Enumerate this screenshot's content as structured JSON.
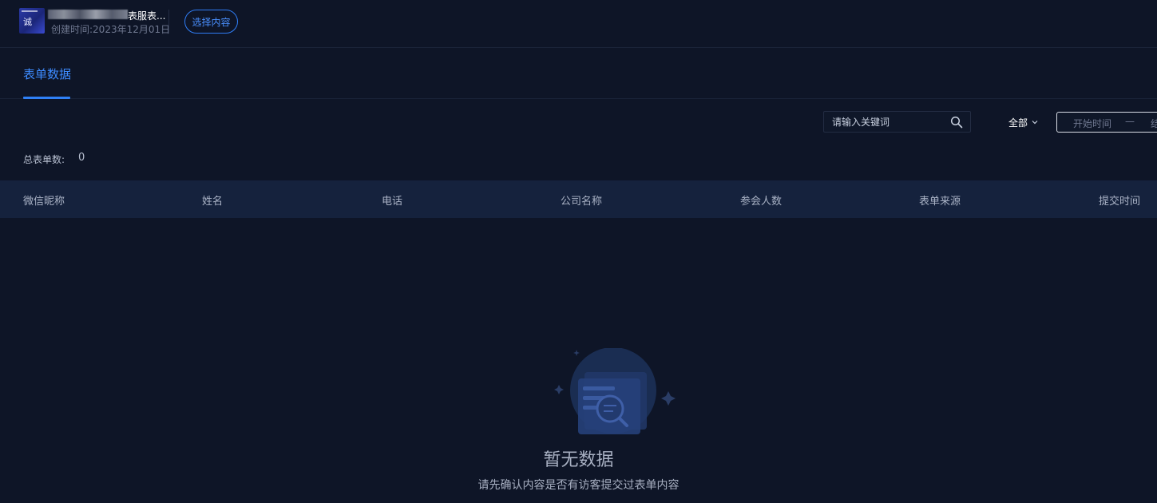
{
  "header": {
    "thumbnail_text": "诚",
    "title_visible_suffix": "表服表...",
    "created_time": "创建时间:2023年12月01日",
    "select_button_label": "选择内容"
  },
  "tabs": [
    {
      "label": "表单数据",
      "active": true
    }
  ],
  "toolbar": {
    "search_placeholder": "请输入关键词",
    "filter_selected": "全部",
    "date_start_placeholder": "开始时间",
    "date_separator": "—",
    "date_end_placeholder": "结"
  },
  "summary": {
    "total_label": "总表单数:",
    "total_value": "0"
  },
  "table": {
    "columns": [
      "微信昵称",
      "姓名",
      "电话",
      "公司名称",
      "参会人数",
      "表单来源",
      "提交时间"
    ],
    "rows": []
  },
  "empty_state": {
    "title": "暂无数据",
    "description": "请先确认内容是否有访客提交过表单内容"
  },
  "colors": {
    "background": "#0e1527",
    "accent": "#2f80f6",
    "table_header_bg": "#15223d"
  }
}
